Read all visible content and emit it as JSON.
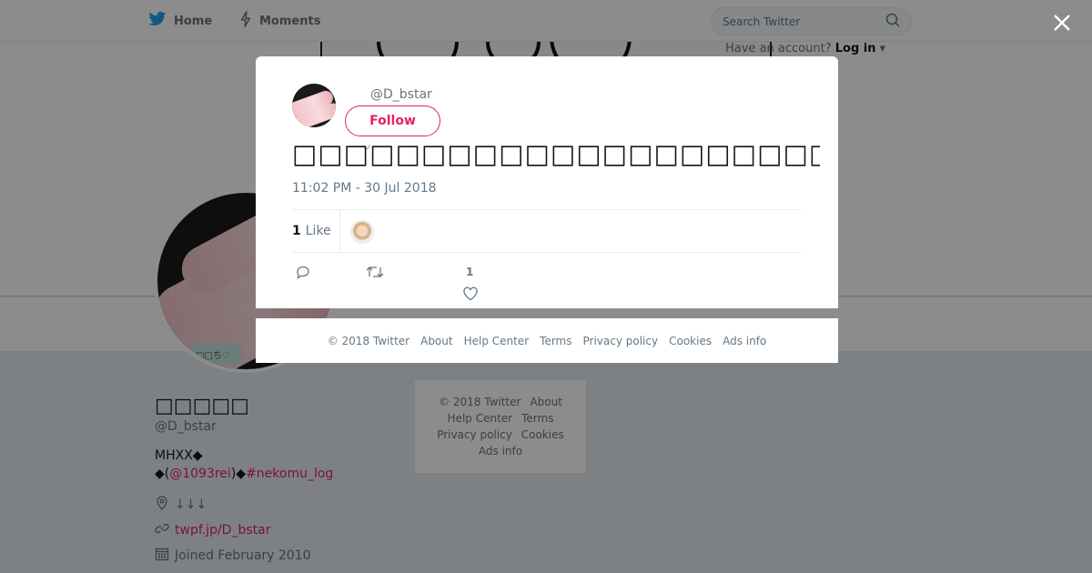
{
  "topbar": {
    "home_label": "Home",
    "moments_label": "Moments",
    "search_placeholder": "Search Twitter",
    "login_prefix": "Have an account?",
    "login_label": "Log in"
  },
  "profile": {
    "display_name": "□□□□□",
    "handle": "@D_bstar",
    "bio_line1": "MHXX◆",
    "bio_line2_prefix": "◆(",
    "bio_mention": "@1093rei",
    "bio_line2_mid": ")◆",
    "bio_hashtag": "#nekomu_log",
    "location": "↓↓↓",
    "website": "twpf.jp/D_bstar",
    "joined": "Joined February 2010",
    "avatar_tag_text": "□□ち♡"
  },
  "side_footer": {
    "copyright": "© 2018 Twitter",
    "about": "About",
    "help": "Help Center",
    "terms": "Terms",
    "privacy": "Privacy policy",
    "cookies": "Cookies",
    "ads": "Ads info"
  },
  "tweet": {
    "handle": "@D_bstar",
    "follow_label": "Follow",
    "text": "□□□□□□□□□□□□□□□□□□□□□□□□□□□□□□□□□□□□□□",
    "timestamp": "11:02 PM - 30 Jul 2018",
    "like_count": "1",
    "like_label": "Like",
    "action_like_count": "1"
  },
  "modal_footer": {
    "copyright": "© 2018 Twitter",
    "about": "About",
    "help": "Help Center",
    "terms": "Terms",
    "privacy": "Privacy policy",
    "cookies": "Cookies",
    "ads": "Ads info"
  },
  "colors": {
    "accent": "#e0245e",
    "twitter_blue": "#1da1f2",
    "overlay": "rgba(0,0,0,0.45)"
  },
  "icons": [
    "twitter-bird-icon",
    "lightning-icon",
    "search-icon",
    "close-icon",
    "reply-icon",
    "retweet-icon",
    "heart-icon",
    "location-icon",
    "link-icon",
    "calendar-icon",
    "chevron-down-icon"
  ]
}
